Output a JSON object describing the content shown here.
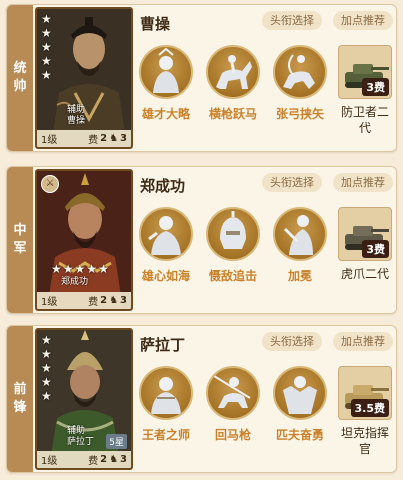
{
  "cards": [
    {
      "position": "统帅",
      "position_chars": [
        "统",
        "帅"
      ],
      "name": "曹操",
      "portrait_tag": "辅助",
      "portrait_name": "曹操",
      "level": "1级",
      "cost_label": "费",
      "cost": "2",
      "count": "3",
      "stars": 5,
      "title_button": "头衔选择",
      "recommend_button": "加点推荐",
      "skills": [
        "雄才大略",
        "横枪跃马",
        "张弓挟矢"
      ],
      "gear": {
        "name": "防卫者二代",
        "name_lines": [
          "防卫者二",
          "代"
        ],
        "count": "3费"
      }
    },
    {
      "position": "中军",
      "position_chars": [
        "中",
        "军"
      ],
      "name": "郑成功",
      "portrait_name": "郑成功",
      "level": "1级",
      "cost_label": "费",
      "cost": "2",
      "count": "3",
      "stars": 5,
      "title_button": "头衔选择",
      "recommend_button": "加点推荐",
      "skills": [
        "雄心如海",
        "慑敌追击",
        "加冕"
      ],
      "gear": {
        "name": "虎爪二代",
        "name_lines": [
          "虎爪二代"
        ],
        "count": "3费"
      }
    },
    {
      "position": "前锋",
      "position_chars": [
        "前",
        "锋"
      ],
      "name": "萨拉丁",
      "portrait_tag": "辅助",
      "portrait_name": "萨拉丁",
      "rank_tag": "5星",
      "level": "1级",
      "cost_label": "费",
      "cost": "2",
      "count": "3",
      "stars": 5,
      "title_button": "头衔选择",
      "recommend_button": "加点推荐",
      "skills": [
        "王者之师",
        "回马枪",
        "匹夫奋勇"
      ],
      "gear": {
        "name": "坦克指挥官",
        "name_lines": [
          "坦克指挥",
          "官"
        ],
        "count": "3.5费"
      }
    }
  ],
  "colors": {
    "background": "#f6ecd9",
    "position_strip": "#b88b55",
    "skill_label": "#c9822a",
    "pill_bg": "#f1e3c7",
    "pill_text": "#8b6a44"
  }
}
